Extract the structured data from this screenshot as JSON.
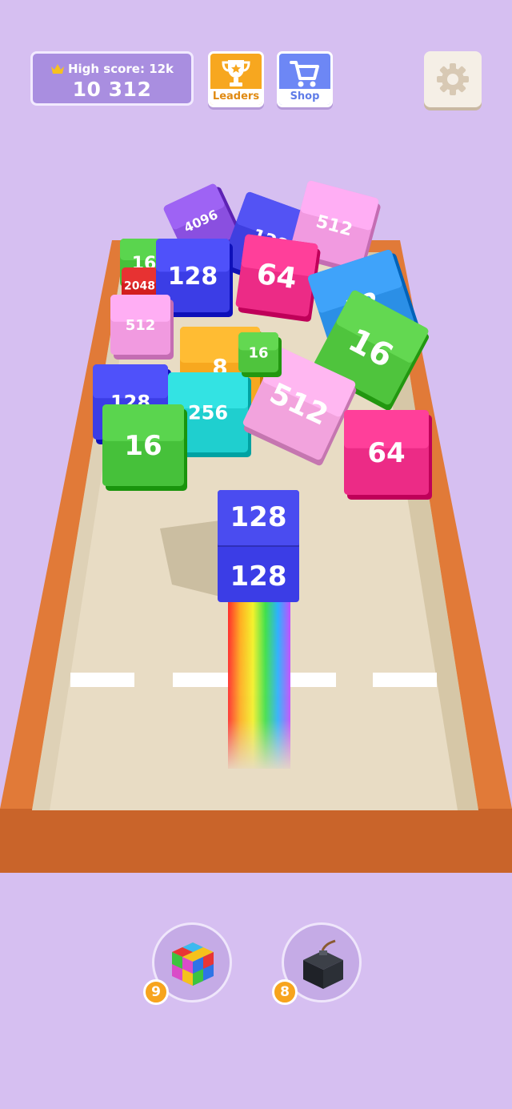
{
  "hud": {
    "high_score_label": "High score: 12k",
    "score": "10 312",
    "leaders_label": "Leaders",
    "shop_label": "Shop"
  },
  "board": {
    "lanes": 4
  },
  "cubes": [
    {
      "value": "4096",
      "color": "#8a4fe0"
    },
    {
      "value": "128",
      "color": "#3f3fe0"
    },
    {
      "value": "512",
      "color": "#f19ae0"
    },
    {
      "value": "16",
      "color": "#46c13a"
    },
    {
      "value": "2048",
      "color": "#d31e1e"
    },
    {
      "value": "128",
      "color": "#3b3de6"
    },
    {
      "value": "64",
      "color": "#ec2b86"
    },
    {
      "value": "32",
      "color": "#2b8fe6"
    },
    {
      "value": "512",
      "color": "#f19ae0"
    },
    {
      "value": "16",
      "color": "#4fc43d"
    },
    {
      "value": "8",
      "color": "#f7a81f"
    },
    {
      "value": "128",
      "color": "#3b3de6"
    },
    {
      "value": "256",
      "color": "#1fcfcf"
    },
    {
      "value": "16",
      "color": "#46c13a"
    },
    {
      "value": "512",
      "color": "#f2a3dd"
    },
    {
      "value": "16",
      "color": "#4fc43d"
    },
    {
      "value": "64",
      "color": "#ec2b86"
    }
  ],
  "player_cube": {
    "value": "128",
    "color": "#3b3de6"
  },
  "powerups": [
    {
      "name": "rainbow-cube",
      "count": "9"
    },
    {
      "name": "bomb",
      "count": "8"
    }
  ]
}
